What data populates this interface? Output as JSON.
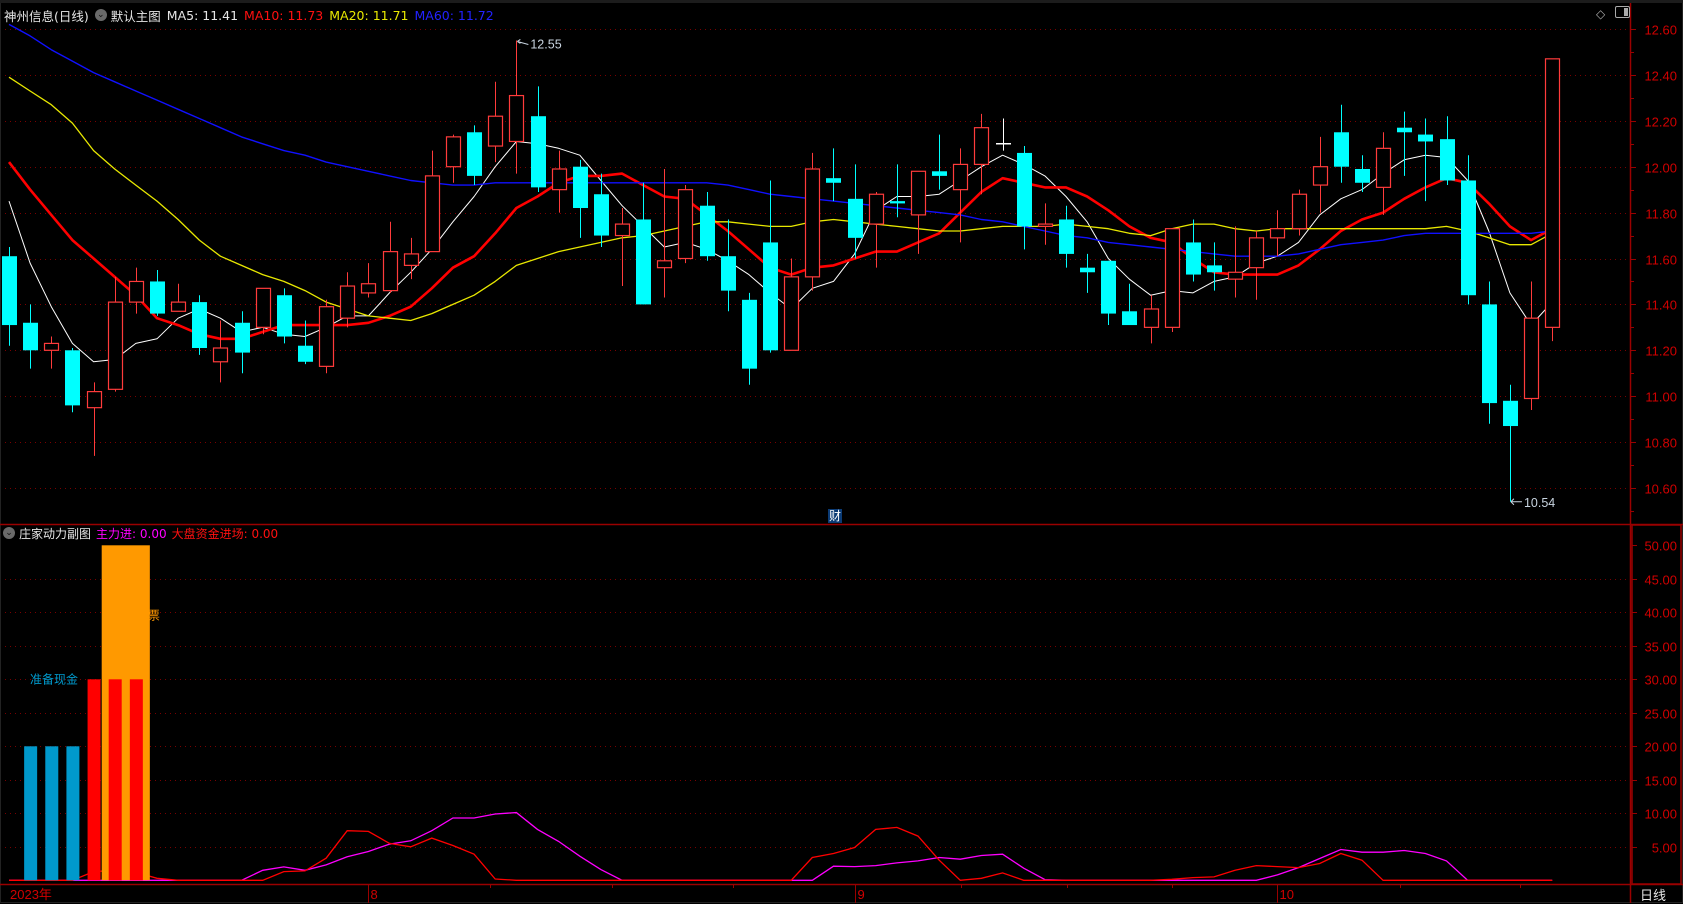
{
  "header": {
    "title": "神州信息(日线)",
    "template": "默认主图",
    "ma5": "MA5: 11.41",
    "ma10": "MA10: 11.73",
    "ma20": "MA20: 11.71",
    "ma60": "MA60: 11.72"
  },
  "sub_header": {
    "title": "庄家动力副图",
    "main_in": "主力进: 0.00",
    "market_in": "大盘资金进场: 0.00"
  },
  "annotations": {
    "high_label": "12.55",
    "low_label": "10.54",
    "cai_marker": "财",
    "ready_cash": "准备现金",
    "ticket": "票"
  },
  "icons": {
    "collapse": "chevron-down-icon",
    "diamond": "diamond-icon",
    "window": "window-toggle-icon"
  },
  "period_label": "日线",
  "date_axis": [
    {
      "text": "2023年",
      "index": 0
    },
    {
      "text": "8",
      "index": 17
    },
    {
      "text": "9",
      "index": 40
    },
    {
      "text": "10",
      "index": 60
    }
  ],
  "colors": {
    "up": "#ff3b3b",
    "down": "#00ffff",
    "ma5": "#ffffff",
    "ma10": "#ff0000",
    "ma20": "#e8e800",
    "ma60": "#1010ff",
    "axis": "#9a0000",
    "axis_text": "#d00000",
    "grid": "#7a0000",
    "main_in": "#ff00ff",
    "market_in": "#ff0000",
    "cash_bar": "#0099cc",
    "red_bar": "#ff0000",
    "orange_bar": "#ff9900"
  },
  "chart_data": [
    {
      "type": "candlestick",
      "title": "神州信息(日线)",
      "ylim": [
        10.5,
        12.7
      ],
      "yticks": [
        "12.60",
        "12.40",
        "12.20",
        "12.00",
        "11.80",
        "11.60",
        "11.40",
        "11.20",
        "11.00",
        "10.80",
        "10.60"
      ],
      "ytick_values": [
        12.6,
        12.4,
        12.2,
        12.0,
        11.8,
        11.6,
        11.4,
        11.2,
        11.0,
        10.8,
        10.6
      ],
      "grid": true,
      "ohlc": [
        [
          11.61,
          11.65,
          11.22,
          11.31
        ],
        [
          11.32,
          11.4,
          11.12,
          11.2
        ],
        [
          11.2,
          11.26,
          11.12,
          11.23
        ],
        [
          11.2,
          11.21,
          10.93,
          10.96
        ],
        [
          10.95,
          11.06,
          10.74,
          11.02
        ],
        [
          11.03,
          11.52,
          11.02,
          11.41
        ],
        [
          11.41,
          11.56,
          11.36,
          11.5
        ],
        [
          11.5,
          11.55,
          11.35,
          11.36
        ],
        [
          11.37,
          11.49,
          11.37,
          11.41
        ],
        [
          11.41,
          11.44,
          11.18,
          11.21
        ],
        [
          11.15,
          11.33,
          11.06,
          11.21
        ],
        [
          11.32,
          11.37,
          11.1,
          11.19
        ],
        [
          11.3,
          11.47,
          11.27,
          11.47
        ],
        [
          11.44,
          11.47,
          11.23,
          11.26
        ],
        [
          11.22,
          11.33,
          11.14,
          11.15
        ],
        [
          11.13,
          11.42,
          11.1,
          11.39
        ],
        [
          11.34,
          11.54,
          11.3,
          11.48
        ],
        [
          11.45,
          11.58,
          11.43,
          11.49
        ],
        [
          11.46,
          11.76,
          11.45,
          11.63
        ],
        [
          11.57,
          11.69,
          11.51,
          11.62
        ],
        [
          11.63,
          12.07,
          11.63,
          11.96
        ],
        [
          12.0,
          12.14,
          11.93,
          12.13
        ],
        [
          12.15,
          12.18,
          11.92,
          11.96
        ],
        [
          12.09,
          12.37,
          12.02,
          12.22
        ],
        [
          12.11,
          12.55,
          11.97,
          12.31
        ],
        [
          12.22,
          12.35,
          11.89,
          11.91
        ],
        [
          11.9,
          12.07,
          11.8,
          11.99
        ],
        [
          12.0,
          12.03,
          11.69,
          11.82
        ],
        [
          11.88,
          11.97,
          11.65,
          11.7
        ],
        [
          11.7,
          11.82,
          11.48,
          11.75
        ],
        [
          11.77,
          11.93,
          11.4,
          11.4
        ],
        [
          11.56,
          11.99,
          11.43,
          11.59
        ],
        [
          11.6,
          11.92,
          11.58,
          11.9
        ],
        [
          11.83,
          11.89,
          11.59,
          11.61
        ],
        [
          11.61,
          11.77,
          11.37,
          11.46
        ],
        [
          11.42,
          11.45,
          11.05,
          11.12
        ],
        [
          11.67,
          11.94,
          11.19,
          11.2
        ],
        [
          11.2,
          11.6,
          11.2,
          11.52
        ],
        [
          11.52,
          12.06,
          11.46,
          11.99
        ],
        [
          11.95,
          12.08,
          11.85,
          11.93
        ],
        [
          11.86,
          12.01,
          11.6,
          11.69
        ],
        [
          11.75,
          11.89,
          11.56,
          11.88
        ],
        [
          11.85,
          12.01,
          11.78,
          11.84
        ],
        [
          11.79,
          11.98,
          11.62,
          11.98
        ],
        [
          11.98,
          12.14,
          11.9,
          11.96
        ],
        [
          11.9,
          12.08,
          11.67,
          12.01
        ],
        [
          12.01,
          12.23,
          11.88,
          12.17
        ],
        [
          12.1,
          12.21,
          12.07,
          12.1
        ],
        [
          12.06,
          12.09,
          11.64,
          11.74
        ],
        [
          11.74,
          11.84,
          11.66,
          11.75
        ],
        [
          11.77,
          11.83,
          11.56,
          11.62
        ],
        [
          11.56,
          11.62,
          11.45,
          11.54
        ],
        [
          11.59,
          11.59,
          11.31,
          11.36
        ],
        [
          11.37,
          11.49,
          11.31,
          11.31
        ],
        [
          11.3,
          11.44,
          11.23,
          11.38
        ],
        [
          11.3,
          11.73,
          11.28,
          11.73
        ],
        [
          11.67,
          11.77,
          11.5,
          11.53
        ],
        [
          11.57,
          11.67,
          11.46,
          11.54
        ],
        [
          11.51,
          11.74,
          11.43,
          11.54
        ],
        [
          11.56,
          11.72,
          11.42,
          11.69
        ],
        [
          11.69,
          11.81,
          11.61,
          11.73
        ],
        [
          11.73,
          11.9,
          11.7,
          11.88
        ],
        [
          11.92,
          12.13,
          11.8,
          12.0
        ],
        [
          12.15,
          12.27,
          11.93,
          12.0
        ],
        [
          11.99,
          12.05,
          11.89,
          11.93
        ],
        [
          11.91,
          12.15,
          11.79,
          12.08
        ],
        [
          12.17,
          12.24,
          11.96,
          12.15
        ],
        [
          12.14,
          12.21,
          11.85,
          12.11
        ],
        [
          12.12,
          12.22,
          11.92,
          11.94
        ],
        [
          11.94,
          12.05,
          11.4,
          11.44
        ],
        [
          11.4,
          11.5,
          10.88,
          10.97
        ],
        [
          10.98,
          11.05,
          10.54,
          10.87
        ],
        [
          10.99,
          11.5,
          10.94,
          11.34
        ],
        [
          11.3,
          12.47,
          11.24,
          12.47
        ]
      ],
      "series": [
        {
          "name": "MA5",
          "values": [
            11.85,
            11.58,
            11.39,
            11.23,
            11.15,
            11.16,
            11.23,
            11.25,
            11.34,
            11.38,
            11.34,
            11.28,
            11.3,
            11.27,
            11.26,
            11.3,
            11.35,
            11.35,
            11.45,
            11.54,
            11.64,
            11.76,
            11.87,
            12.0,
            12.11,
            12.1,
            12.08,
            12.05,
            11.94,
            11.83,
            11.74,
            11.65,
            11.67,
            11.64,
            11.59,
            11.53,
            11.45,
            11.38,
            11.47,
            11.5,
            11.62,
            11.81,
            11.87,
            11.87,
            11.88,
            11.94,
            12.0,
            12.05,
            12.01,
            11.96,
            11.87,
            11.76,
            11.6,
            11.51,
            11.44,
            11.46,
            11.45,
            11.5,
            11.52,
            11.58,
            11.61,
            11.67,
            11.79,
            11.86,
            11.9,
            11.97,
            12.03,
            12.05,
            12.04,
            11.94,
            11.72,
            11.45,
            11.31,
            11.41
          ]
        },
        {
          "name": "MA10",
          "values": [
            12.02,
            11.9,
            11.79,
            11.68,
            11.6,
            11.52,
            11.44,
            11.34,
            11.31,
            11.27,
            11.25,
            11.25,
            11.28,
            11.31,
            11.31,
            11.31,
            11.31,
            11.32,
            11.35,
            11.39,
            11.47,
            11.56,
            11.61,
            11.71,
            11.82,
            11.87,
            11.93,
            11.96,
            11.96,
            11.97,
            11.92,
            11.87,
            11.86,
            11.79,
            11.72,
            11.64,
            11.56,
            11.53,
            11.56,
            11.57,
            11.6,
            11.63,
            11.63,
            11.67,
            11.71,
            11.8,
            11.89,
            11.95,
            11.93,
            11.91,
            11.91,
            11.87,
            11.81,
            11.74,
            11.69,
            11.67,
            11.6,
            11.54,
            11.53,
            11.53,
            11.53,
            11.57,
            11.64,
            11.72,
            11.77,
            11.8,
            11.86,
            11.91,
            11.95,
            11.93,
            11.84,
            11.74,
            11.68,
            11.73
          ]
        },
        {
          "name": "MA20",
          "values": [
            12.39,
            12.33,
            12.27,
            12.19,
            12.07,
            11.99,
            11.92,
            11.85,
            11.77,
            11.68,
            11.61,
            11.57,
            11.53,
            11.5,
            11.46,
            11.41,
            11.38,
            11.35,
            11.34,
            11.33,
            11.36,
            11.4,
            11.44,
            11.5,
            11.57,
            11.6,
            11.63,
            11.65,
            11.67,
            11.69,
            11.7,
            11.72,
            11.74,
            11.76,
            11.76,
            11.75,
            11.74,
            11.74,
            11.76,
            11.77,
            11.76,
            11.75,
            11.74,
            11.73,
            11.72,
            11.72,
            11.73,
            11.74,
            11.74,
            11.74,
            11.75,
            11.74,
            11.73,
            11.71,
            11.7,
            11.73,
            11.75,
            11.75,
            11.73,
            11.72,
            11.73,
            11.73,
            11.73,
            11.73,
            11.73,
            11.73,
            11.73,
            11.73,
            11.74,
            11.72,
            11.69,
            11.66,
            11.66,
            11.71
          ]
        },
        {
          "name": "MA60",
          "values": [
            12.62,
            12.57,
            12.51,
            12.46,
            12.41,
            12.37,
            12.33,
            12.29,
            12.25,
            12.21,
            12.17,
            12.13,
            12.1,
            12.07,
            12.05,
            12.02,
            12.0,
            11.98,
            11.96,
            11.94,
            11.93,
            11.92,
            11.92,
            11.93,
            11.93,
            11.93,
            11.93,
            11.93,
            11.93,
            11.93,
            11.93,
            11.93,
            11.93,
            11.93,
            11.92,
            11.9,
            11.88,
            11.87,
            11.86,
            11.85,
            11.84,
            11.83,
            11.82,
            11.81,
            11.8,
            11.79,
            11.77,
            11.76,
            11.74,
            11.72,
            11.7,
            11.69,
            11.67,
            11.66,
            11.65,
            11.64,
            11.63,
            11.62,
            11.61,
            11.61,
            11.61,
            11.62,
            11.64,
            11.66,
            11.67,
            11.68,
            11.7,
            11.71,
            11.71,
            11.71,
            11.71,
            11.71,
            11.71,
            11.72
          ]
        }
      ],
      "high_mark": {
        "index": 24,
        "value": 12.55
      },
      "low_mark": {
        "index": 71,
        "value": 10.54
      },
      "cai_index": 39
    },
    {
      "type": "bar+line",
      "title": "庄家动力副图",
      "ylim": [
        0,
        52
      ],
      "yticks": [
        "50.00",
        "45.00",
        "40.00",
        "35.00",
        "30.00",
        "25.00",
        "20.00",
        "15.00",
        "10.00",
        "5.00"
      ],
      "ytick_values": [
        50,
        45,
        40,
        35,
        30,
        25,
        20,
        15,
        10,
        5
      ],
      "bars": {
        "cash": {
          "indices": [
            1,
            2,
            3
          ],
          "value": 20
        },
        "orange": {
          "from_index": 5,
          "to_index": 6,
          "value": 50
        },
        "red": {
          "indices": [
            4,
            5,
            6
          ],
          "value": 30
        }
      },
      "series": [
        {
          "name": "主力进",
          "values": [
            0,
            0,
            0,
            0,
            0,
            0,
            0,
            0,
            0,
            0,
            0,
            0,
            1.5,
            2.0,
            1.5,
            2.3,
            3.5,
            4.3,
            5.4,
            5.9,
            7.4,
            9.3,
            9.3,
            9.9,
            10.1,
            7.6,
            5.8,
            3.6,
            1.6,
            0,
            0,
            0,
            0,
            0,
            0,
            0,
            0,
            0,
            0,
            2.1,
            2.05,
            2.2,
            2.6,
            2.9,
            3.4,
            3.15,
            3.7,
            3.9,
            1.8,
            0.1,
            0,
            0,
            0,
            0,
            0,
            0,
            0,
            0,
            0,
            0,
            0.8,
            1.9,
            3.25,
            4.6,
            4.2,
            4.2,
            4.45,
            4.0,
            2.9,
            0,
            0,
            0,
            0,
            0
          ]
        },
        {
          "name": "大盘资金进场",
          "values": [
            0,
            0,
            0,
            0,
            1.3,
            1.5,
            1.2,
            0.3,
            0,
            0,
            0,
            0,
            0,
            1.3,
            1.4,
            3.3,
            7.4,
            7.3,
            5.5,
            5.0,
            6.3,
            5.2,
            3.9,
            0.2,
            0,
            0,
            0,
            0,
            0,
            0,
            0,
            0,
            0,
            0,
            0,
            0,
            0,
            0,
            3.4,
            4.0,
            4.9,
            7.6,
            7.9,
            6.6,
            3.0,
            0,
            0.3,
            1.1,
            0,
            0,
            0,
            0,
            0,
            0,
            0,
            0.15,
            0.4,
            0.5,
            1.5,
            2.2,
            2.05,
            1.9,
            2.5,
            4.0,
            3.0,
            0,
            0,
            0,
            0,
            0,
            0,
            0,
            0,
            0
          ]
        }
      ]
    }
  ]
}
